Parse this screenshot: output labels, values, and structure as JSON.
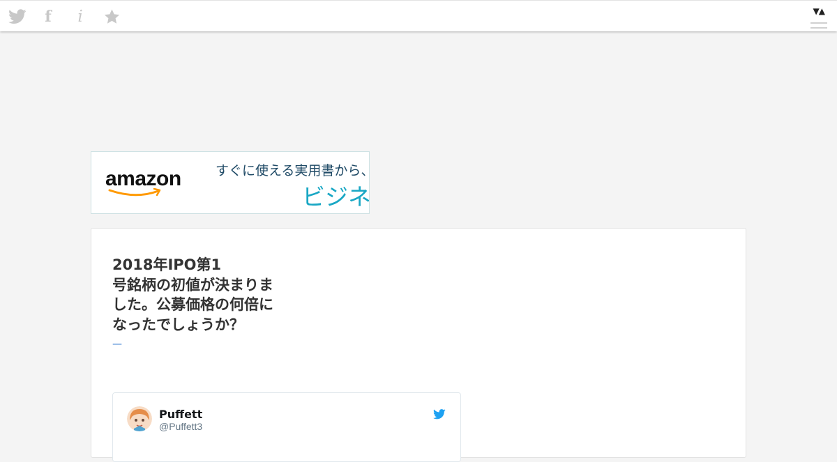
{
  "topbar": {
    "icons": [
      "twitter-icon",
      "facebook-icon",
      "info-icon",
      "star-icon"
    ],
    "facebook_glyph": "f",
    "info_glyph": "i",
    "sort_glyph": "▼▲",
    "icon_color": "#c8c8c8"
  },
  "banner": {
    "logo_text": "amazon",
    "tagline": "すぐに使える実用書から、話",
    "headline": "ビジネス",
    "accent_color": "#ff9900"
  },
  "post": {
    "lines": [
      "2018年IPO第1",
      "号銘柄の初値が決まりま",
      "した。公募価格の何倍に",
      "なったでしょうか？"
    ],
    "link_text": "—",
    "link_color": "#3b7fd1"
  },
  "tweet": {
    "name": "Puffett",
    "handle": "@Puffett3",
    "brand_color": "#1da1f2"
  }
}
